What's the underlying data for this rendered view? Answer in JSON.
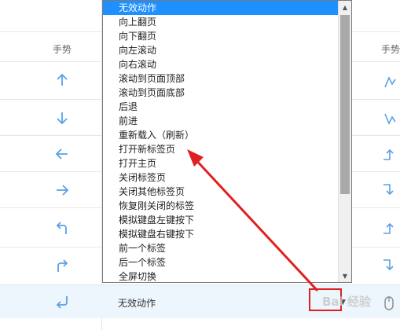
{
  "table": {
    "header_left": "手势",
    "header_right": "手势",
    "selected_row_action": "无效动作"
  },
  "gestures": [
    {
      "icon": "arrow-up-icon"
    },
    {
      "icon": "arrow-down-icon"
    },
    {
      "icon": "arrow-left-icon"
    },
    {
      "icon": "arrow-right-icon"
    },
    {
      "icon": "arrow-up-left-turn-icon"
    },
    {
      "icon": "arrow-up-right-turn-icon"
    },
    {
      "icon": "arrow-down-left-return-icon"
    }
  ],
  "dropdown": {
    "items": [
      "无效动作",
      "向上翻页",
      "向下翻页",
      "向左滚动",
      "向右滚动",
      "滚动到页面顶部",
      "滚动到页面底部",
      "后退",
      "前进",
      "重新载入（刷新）",
      "打开新标签页",
      "打开主页",
      "关闭标签页",
      "关闭其他标签页",
      "恢复刚关闭的标签",
      "模拟键盘左键按下",
      "模拟键盘右键按下",
      "前一个标签",
      "后一个标签",
      "全屏切换"
    ],
    "selected": "无效动作"
  },
  "watermark": "Bai 经验",
  "colors": {
    "icon_blue": "#5aa0e6",
    "highlight_row": "#edf5fd",
    "selected_item": "#1e90ff",
    "annotation_red": "#e02020"
  }
}
